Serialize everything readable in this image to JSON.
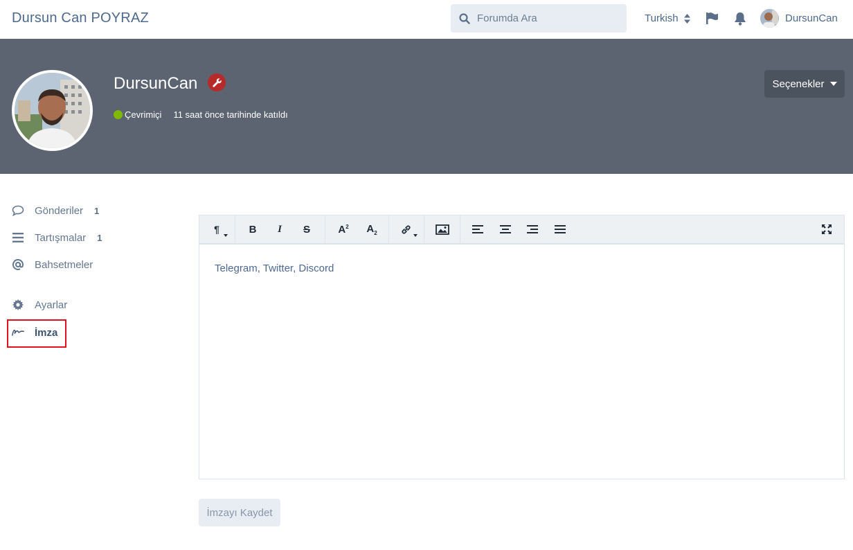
{
  "header": {
    "brand": "Dursun Can POYRAZ",
    "search_placeholder": "Forumda Ara",
    "language": "Turkish",
    "username": "DursunCan"
  },
  "hero": {
    "username": "DursunCan",
    "status": "Çevrimiçi",
    "joined": "11 saat önce tarihinde katıldı",
    "options_label": "Seçenekler"
  },
  "sidebar": {
    "items": [
      {
        "label": "Gönderiler",
        "count": "1",
        "icon": "comment-icon"
      },
      {
        "label": "Tartışmalar",
        "count": "1",
        "icon": "list-icon"
      },
      {
        "label": "Bahsetmeler",
        "count": "",
        "icon": "at-icon"
      },
      {
        "label": "Ayarlar",
        "count": "",
        "icon": "gear-icon"
      },
      {
        "label": "İmza",
        "count": "",
        "icon": "signature-icon"
      }
    ]
  },
  "editor": {
    "content": "Telegram, Twitter, Discord"
  },
  "save_label": "İmzayı Kaydet",
  "colors": {
    "hero_bg": "#5b6470",
    "accent": "#4d698e",
    "online": "#7fba00",
    "badge": "#b72a2a",
    "highlight": "#e0101c"
  }
}
